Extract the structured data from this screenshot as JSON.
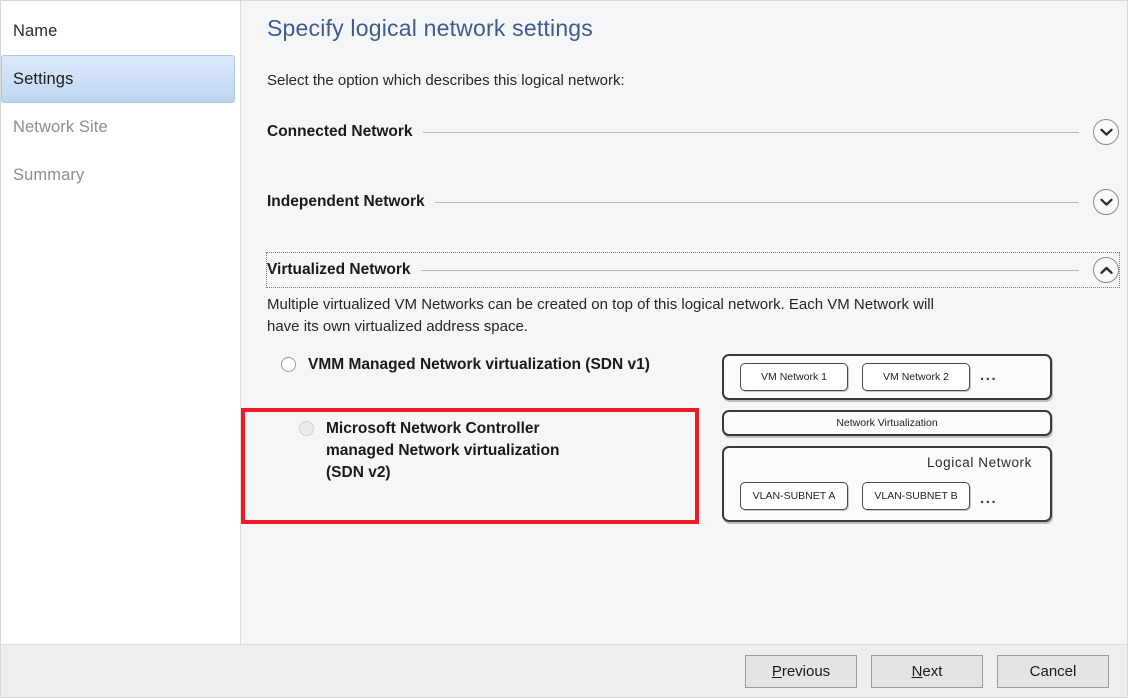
{
  "sidebar": {
    "items": [
      {
        "label": "Name",
        "state": "done"
      },
      {
        "label": "Settings",
        "state": "active"
      },
      {
        "label": "Network Site",
        "state": "pending"
      },
      {
        "label": "Summary",
        "state": "pending"
      }
    ]
  },
  "main": {
    "title": "Specify logical network settings",
    "intro": "Select the option which describes this logical network:",
    "sections": [
      {
        "title": "Connected Network",
        "expanded": false,
        "chevron_icon": "chevron-down-icon"
      },
      {
        "title": "Independent Network",
        "expanded": false,
        "chevron_icon": "chevron-down-icon"
      },
      {
        "title": "Virtualized Network",
        "expanded": true,
        "focused": true,
        "chevron_icon": "chevron-up-icon",
        "description": "Multiple virtualized VM Networks can be created on top of this logical network. Each VM Network will have its own virtualized address space."
      }
    ],
    "options": [
      {
        "label": "VMM Managed Network virtualization (SDN v1)",
        "selected": false,
        "muted": false
      },
      {
        "label": "Microsoft Network Controller managed Network virtualization (SDN v2)",
        "selected": false,
        "muted": true
      }
    ],
    "annotation": {
      "type": "highlight-rectangle",
      "color": "#EE1B22",
      "targets_option_index": 1
    }
  },
  "diagram": {
    "vm_layer": {
      "chips": [
        "VM Network 1",
        "VM Network 2"
      ],
      "overflow": "..."
    },
    "middle_layer": {
      "label": "Network Virtualization"
    },
    "logical_layer": {
      "caption": "Logical  Network",
      "chips": [
        "VLAN-SUBNET A",
        "VLAN-SUBNET B"
      ],
      "overflow": "..."
    }
  },
  "footer": {
    "buttons": [
      {
        "prefix": "",
        "accel": "P",
        "suffix": "revious",
        "name": "previous-button"
      },
      {
        "prefix": "",
        "accel": "N",
        "suffix": "ext",
        "name": "next-button"
      },
      {
        "prefix": "Cancel",
        "accel": "",
        "suffix": "",
        "name": "cancel-button"
      }
    ]
  },
  "colors": {
    "title": "#3F5B8C",
    "accent_highlight": "#EE1B22",
    "nav_active_bg": "#CFE0F6",
    "content_bg": "#F4F6F8"
  }
}
